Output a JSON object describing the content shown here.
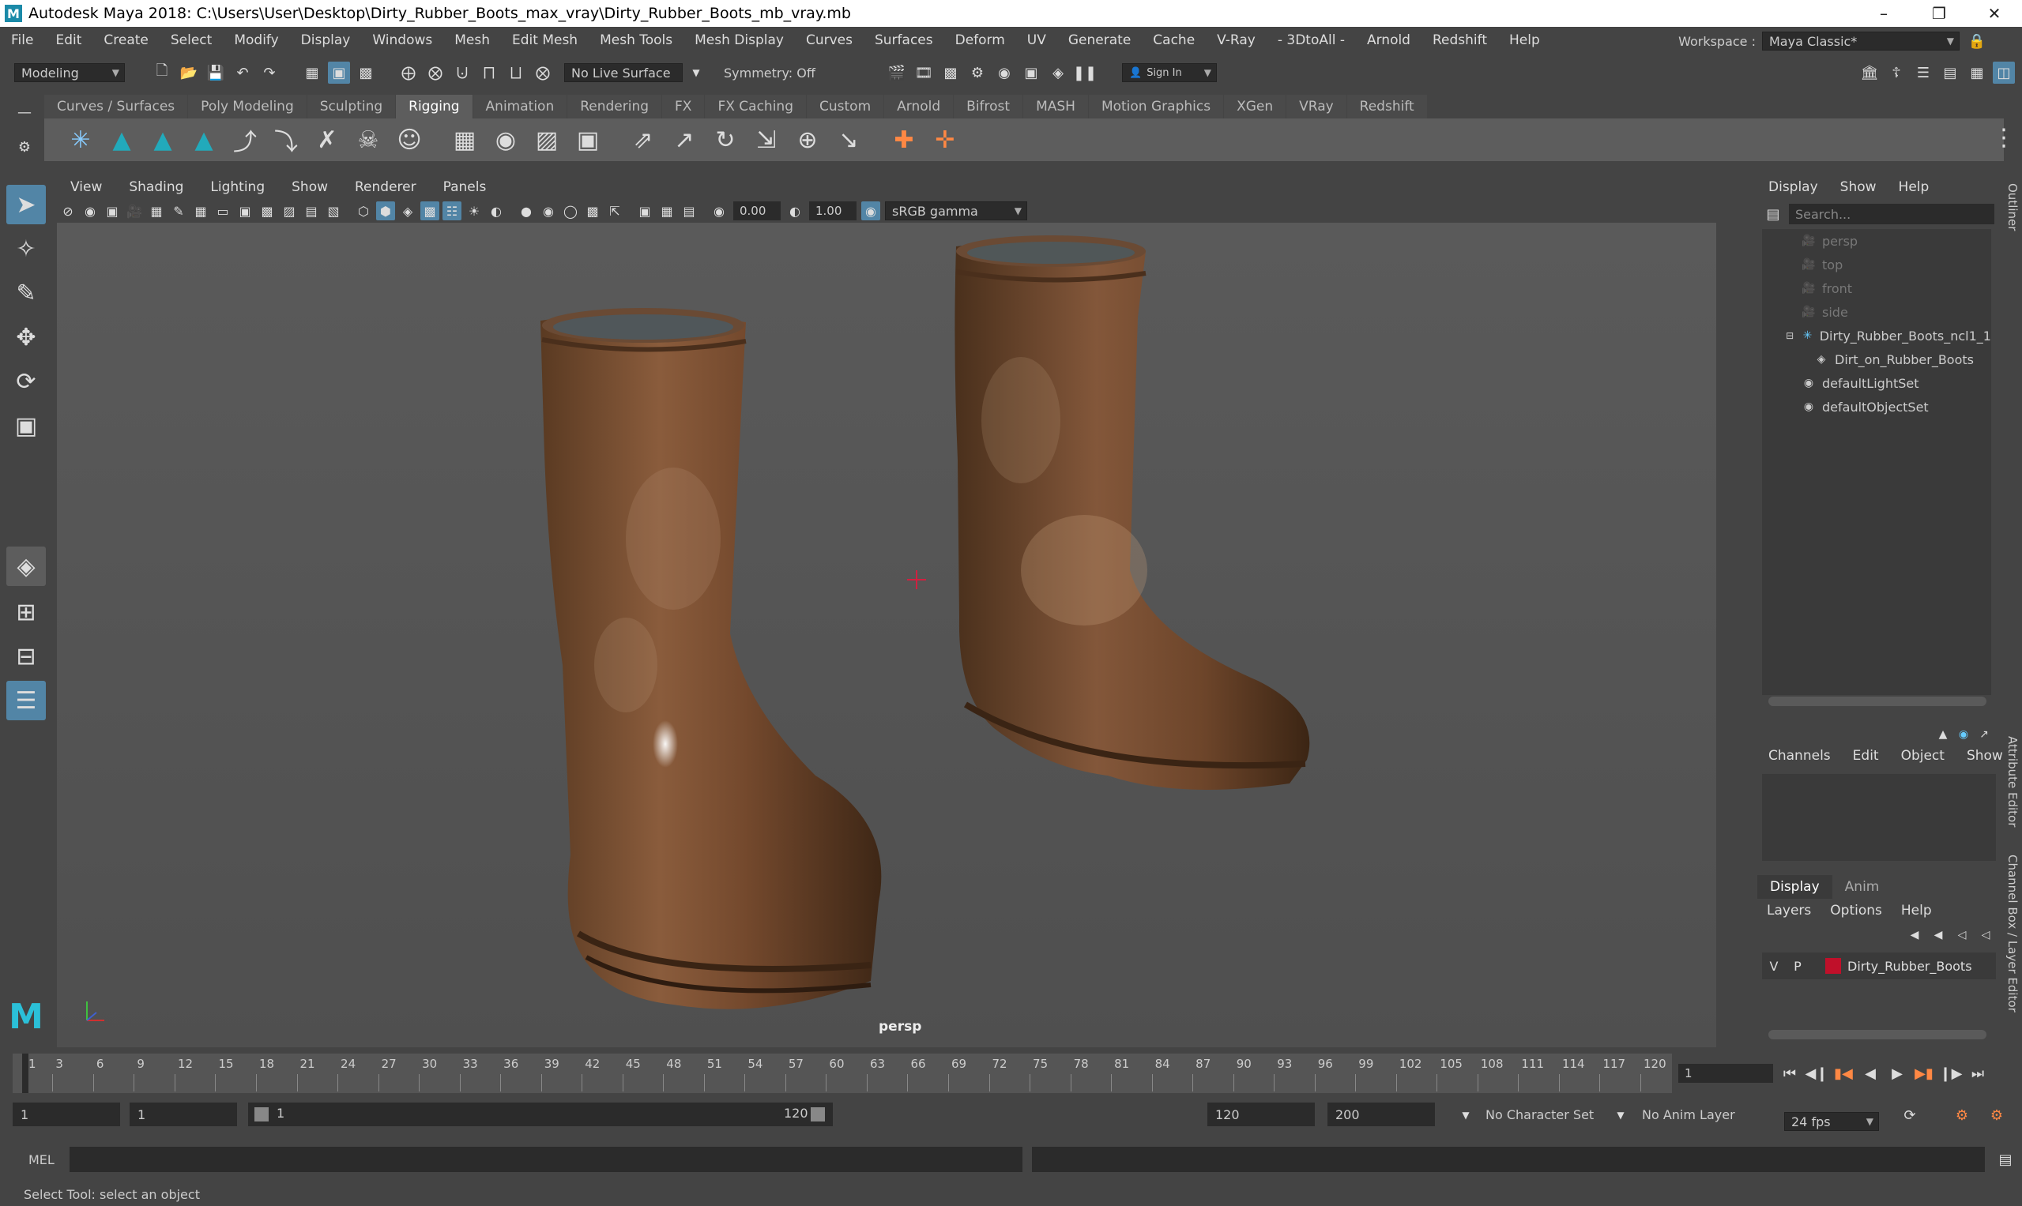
{
  "window": {
    "title": "Autodesk Maya 2018: C:\\Users\\User\\Desktop\\Dirty_Rubber_Boots_max_vray\\Dirty_Rubber_Boots_mb_vray.mb",
    "app_logo": "M"
  },
  "menubar": {
    "items": [
      "File",
      "Edit",
      "Create",
      "Select",
      "Modify",
      "Display",
      "Windows",
      "Mesh",
      "Edit Mesh",
      "Mesh Tools",
      "Mesh Display",
      "Curves",
      "Surfaces",
      "Deform",
      "UV",
      "Generate",
      "Cache",
      "V-Ray",
      "- 3DtoAll -",
      "Arnold",
      "Redshift",
      "Help"
    ],
    "workspace_label": "Workspace :",
    "workspace_value": "Maya Classic*"
  },
  "statusline": {
    "mode": "Modeling",
    "live_surface": "No Live Surface",
    "symmetry": "Symmetry: Off",
    "sign_in": "Sign In"
  },
  "shelf": {
    "tabs": [
      "Curves / Surfaces",
      "Poly Modeling",
      "Sculpting",
      "Rigging",
      "Animation",
      "Rendering",
      "FX",
      "FX Caching",
      "Custom",
      "Arnold",
      "Bifrost",
      "MASH",
      "Motion Graphics",
      "XGen",
      "VRay",
      "Redshift"
    ],
    "active_tab": "Rigging"
  },
  "viewport": {
    "menu": [
      "View",
      "Shading",
      "Lighting",
      "Show",
      "Renderer",
      "Panels"
    ],
    "exposure": "0.00",
    "gamma": "1.00",
    "color_space": "sRGB gamma",
    "camera": "persp"
  },
  "outliner": {
    "menu": [
      "Display",
      "Show",
      "Help"
    ],
    "search_placeholder": "Search...",
    "items": [
      {
        "label": "persp",
        "icon": "camera-icon",
        "dim": true,
        "indent": 1
      },
      {
        "label": "top",
        "icon": "camera-icon",
        "dim": true,
        "indent": 1
      },
      {
        "label": "front",
        "icon": "camera-icon",
        "dim": true,
        "indent": 1
      },
      {
        "label": "side",
        "icon": "camera-icon",
        "dim": true,
        "indent": 1
      },
      {
        "label": "Dirty_Rubber_Boots_ncl1_1",
        "icon": "group-icon",
        "dim": false,
        "indent": 1
      },
      {
        "label": "Dirt_on_Rubber_Boots",
        "icon": "mesh-icon",
        "dim": false,
        "indent": 2
      },
      {
        "label": "defaultLightSet",
        "icon": "set-icon",
        "dim": false,
        "indent": 1
      },
      {
        "label": "defaultObjectSet",
        "icon": "set-icon",
        "dim": false,
        "indent": 1
      }
    ]
  },
  "channelbox": {
    "menu": [
      "Channels",
      "Edit",
      "Object",
      "Show"
    ]
  },
  "layers": {
    "tabs": [
      "Display",
      "Anim"
    ],
    "active_tab": "Display",
    "menu": [
      "Layers",
      "Options",
      "Help"
    ],
    "layer": {
      "v": "V",
      "p": "P",
      "name": "Dirty_Rubber_Boots",
      "color": "#c0102a"
    }
  },
  "side_tabs": [
    "Outliner",
    "Attribute Editor",
    "Channel Box / Layer Editor"
  ],
  "timeline": {
    "ticks": [
      "1",
      "3",
      "6",
      "9",
      "12",
      "15",
      "18",
      "21",
      "24",
      "27",
      "30",
      "33",
      "36",
      "39",
      "42",
      "45",
      "48",
      "51",
      "54",
      "57",
      "60",
      "63",
      "66",
      "69",
      "72",
      "75",
      "78",
      "81",
      "84",
      "87",
      "90",
      "93",
      "96",
      "99",
      "102",
      "105",
      "108",
      "111",
      "114",
      "117",
      "120"
    ],
    "current_frame": "1"
  },
  "range": {
    "start": "1",
    "playback_start": "1",
    "slider_start": "1",
    "slider_end": "120",
    "playback_end": "120",
    "end": "200",
    "character_set": "No Character Set",
    "anim_layer": "No Anim Layer",
    "fps": "24 fps"
  },
  "command": {
    "label": "MEL"
  },
  "help_line": "Select Tool: select an object",
  "colors": {
    "accent": "#5285a6",
    "panel": "#444444",
    "viewport": "#555555",
    "field": "#2b2b2b",
    "layer": "#c0102a"
  }
}
